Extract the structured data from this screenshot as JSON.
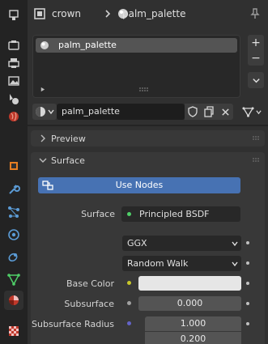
{
  "header": {
    "object_name": "crown",
    "material_name": "palm_palette"
  },
  "tabs": [
    {
      "name": "tool-tab",
      "icon": "tool-icon"
    },
    {
      "name": "render-tab",
      "icon": "camera-back-icon"
    },
    {
      "name": "output-tab",
      "icon": "printer-icon"
    },
    {
      "name": "view-layer-tab",
      "icon": "image-icon"
    },
    {
      "name": "scene-tab",
      "icon": "scene-icon"
    },
    {
      "name": "world-tab",
      "icon": "world-icon"
    },
    {
      "name": "object-tab",
      "icon": "object-icon"
    },
    {
      "name": "modifiers-tab",
      "icon": "wrench-icon"
    },
    {
      "name": "particles-tab",
      "icon": "particles-icon"
    },
    {
      "name": "physics-tab",
      "icon": "physics-icon"
    },
    {
      "name": "constraints-tab",
      "icon": "constraints-icon"
    },
    {
      "name": "data-tab",
      "icon": "mesh-data-icon"
    },
    {
      "name": "material-tab",
      "icon": "material-icon",
      "active": true
    },
    {
      "name": "texture-tab",
      "icon": "checker-icon"
    }
  ],
  "material_slots": [
    {
      "label": "palm_palette",
      "selected": true
    }
  ],
  "material_selector": {
    "name": "palm_palette"
  },
  "panels": {
    "preview": "Preview",
    "surface": "Surface"
  },
  "surface": {
    "use_nodes": "Use Nodes",
    "surface_label": "Surface",
    "surface_value": "Principled BSDF",
    "distribution": "GGX",
    "subsurface_method": "Random Walk",
    "base_color_label": "Base Color",
    "base_color": "#e6e6e6",
    "subsurface_label": "Subsurface",
    "subsurface_value": "0.000",
    "subsurface_radius_label": "Subsurface Radius",
    "subsurface_radius": [
      "1.000",
      "0.200"
    ]
  },
  "colors": {
    "accent": "#4772b3",
    "surface_socket": "#4fcf68",
    "color_socket": "#c7c729",
    "float_socket": "#a1a1a1",
    "vector_socket": "#6363c7"
  }
}
